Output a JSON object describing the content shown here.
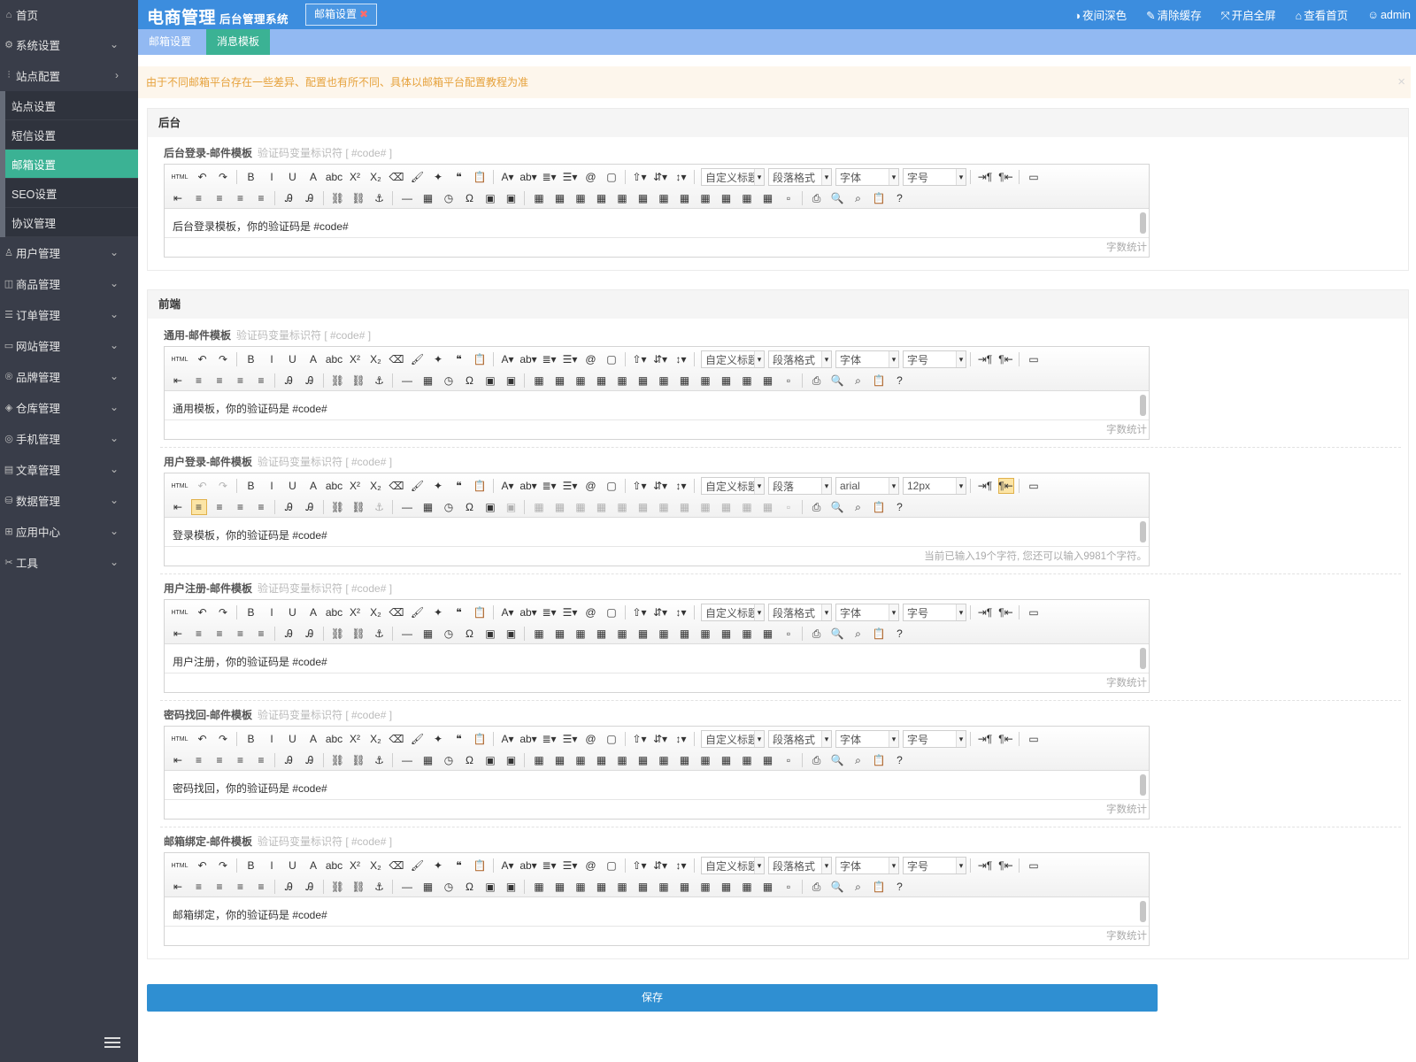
{
  "app": {
    "brand": "电商管理",
    "subtitle": "后台管理系统"
  },
  "topbar": {
    "open_tab": "邮箱设置",
    "tools": [
      {
        "icon": "half-circle-icon",
        "glyph": "◑",
        "label": "夜间深色"
      },
      {
        "icon": "brush-icon",
        "glyph": "✎",
        "label": "清除缓存"
      },
      {
        "icon": "fullscreen-icon",
        "glyph": "⤧",
        "label": "开启全屏"
      },
      {
        "icon": "home-icon",
        "glyph": "⌂",
        "label": "查看首页"
      },
      {
        "icon": "user-icon",
        "glyph": "☺",
        "label": "admin"
      }
    ]
  },
  "sidebar": {
    "home": "首页",
    "groups": [
      {
        "label": "系统设置",
        "icon": "gear-icon",
        "glyph": "⚙",
        "chev": "⌄"
      },
      {
        "label": "站点配置",
        "icon": "sliders-icon",
        "glyph": "⫶",
        "chev": "›"
      }
    ],
    "sub_items": [
      "站点设置",
      "短信设置",
      "邮箱设置",
      "SEO设置",
      "协议管理"
    ],
    "active_sub": 2,
    "rest": [
      {
        "label": "用户管理",
        "icon": "users-icon",
        "glyph": "♙"
      },
      {
        "label": "商品管理",
        "icon": "bag-icon",
        "glyph": "◫"
      },
      {
        "label": "订单管理",
        "icon": "list-icon",
        "glyph": "☰"
      },
      {
        "label": "网站管理",
        "icon": "monitor-icon",
        "glyph": "▭"
      },
      {
        "label": "品牌管理",
        "icon": "badge-icon",
        "glyph": "®"
      },
      {
        "label": "仓库管理",
        "icon": "cubes-icon",
        "glyph": "◈"
      },
      {
        "label": "手机管理",
        "icon": "mobile-icon",
        "glyph": "◎"
      },
      {
        "label": "文章管理",
        "icon": "book-icon",
        "glyph": "▤"
      },
      {
        "label": "数据管理",
        "icon": "database-icon",
        "glyph": "⛁"
      },
      {
        "label": "应用中心",
        "icon": "apps-icon",
        "glyph": "⊞"
      },
      {
        "label": "工具",
        "icon": "wrench-icon",
        "glyph": "✂"
      }
    ]
  },
  "subtabs": [
    "邮箱设置",
    "消息模板"
  ],
  "active_subtab": 1,
  "alert": {
    "text": "由于不同邮箱平台存在一些差异、配置也有所不同、具体以邮箱平台配置教程为准",
    "close": "×"
  },
  "sections": [
    {
      "title": "后台",
      "fields": [
        {
          "label": "后台登录-邮件模板",
          "hint": "验证码变量标识符 [ #code# ]",
          "content": "后台登录模板，你的验证码是  #code#",
          "footer": "字数统计"
        }
      ]
    },
    {
      "title": "前端",
      "fields": [
        {
          "label": "通用-邮件模板",
          "hint": "验证码变量标识符 [ #code# ]",
          "content": "通用模板，你的验证码是  #code#",
          "footer": "字数统计"
        },
        {
          "label": "用户登录-邮件模板",
          "hint": "验证码变量标识符 [ #code# ]",
          "content": "登录模板，你的验证码是  #code#",
          "footer": "当前已输入19个字符, 您还可以输入9981个字符。",
          "focused": true
        },
        {
          "label": "用户注册-邮件模板",
          "hint": "验证码变量标识符 [ #code# ]",
          "content": "用户注册，你的验证码是  #code#",
          "footer": "字数统计"
        },
        {
          "label": "密码找回-邮件模板",
          "hint": "验证码变量标识符 [ #code# ]",
          "content": "密码找回，你的验证码是  #code#",
          "footer": "字数统计"
        },
        {
          "label": "邮箱绑定-邮件模板",
          "hint": "验证码变量标识符 [ #code# ]",
          "content": "邮箱绑定，你的验证码是  #code#",
          "footer": "字数统计"
        }
      ]
    }
  ],
  "editor_selects_default": [
    "自定义标题",
    "段落格式",
    "字体",
    "字号"
  ],
  "editor_selects_focused": [
    "自定义标题",
    "段落",
    "arial",
    "12px"
  ],
  "save_label": "保存",
  "toolbar_glyphs": {
    "row1": [
      "HTML",
      "↶",
      "↷",
      "|",
      "B",
      "I",
      "U",
      "A",
      "abc",
      "X²",
      "X₂",
      "⌫",
      "🖌",
      "✦",
      "❝",
      "📋",
      "|",
      "A▾",
      "ab▾",
      "≣▾",
      "☰▾",
      "@",
      "▢",
      "|",
      "⇧▾",
      "⇵▾",
      "↕▾",
      "|",
      "SEL",
      "SEL",
      "SEL",
      "SEL",
      "|",
      "⇥¶",
      "¶⇤",
      "|",
      "▭"
    ],
    "row2": [
      "⇤",
      "≡",
      "≡",
      "≡",
      "≡",
      "|",
      "Ꭿ",
      "Ꭿ",
      "|",
      "⛓",
      "⛓",
      "⚓",
      "|",
      "—",
      "▦",
      "◷",
      "Ω",
      "▣",
      "▣",
      "|",
      "▦",
      "▦",
      "▦",
      "▦",
      "▦",
      "▦",
      "▦",
      "▦",
      "▦",
      "▦",
      "▦",
      "▦",
      "▫",
      "|",
      "⎙",
      "🔍",
      "⌕",
      "📋",
      "?"
    ]
  },
  "colors": {
    "sidebar": "#393d49",
    "topbar": "#3c8dde",
    "subbar": "#92b9f2",
    "active": "#3bb294",
    "save": "#2f8fd2",
    "alert_text": "#e6a23c"
  }
}
